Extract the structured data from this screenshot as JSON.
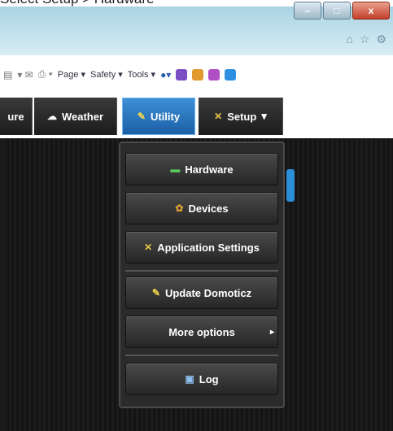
{
  "caption": "Select Setup > Hardware",
  "window": {
    "buttons": [
      "–",
      "□",
      "x"
    ],
    "toolbar_icons": [
      "home-icon",
      "star-icon",
      "gear-icon"
    ]
  },
  "command_bar": {
    "items": [
      {
        "label": "Page ▾",
        "icon": "page-icon"
      },
      {
        "label": "Safety ▾",
        "icon": "safety-icon"
      },
      {
        "label": "Tools ▾",
        "icon": "tools-icon"
      }
    ]
  },
  "nav": {
    "tabs": [
      {
        "label": "ure",
        "icon": ""
      },
      {
        "label": "Weather",
        "icon": "cloud-icon"
      },
      {
        "label": "Utility",
        "icon": "wrench-icon",
        "active": true
      },
      {
        "label": "Setup",
        "icon": "tools-icon",
        "dropdown": "▾"
      }
    ]
  },
  "menu": {
    "items": [
      {
        "label": "Hardware",
        "icon": "hardware-icon"
      },
      {
        "label": "Devices",
        "icon": "devices-icon"
      },
      {
        "label": "Application Settings",
        "icon": "settings-icon"
      },
      {
        "label": "Update Domoticz",
        "icon": "update-icon"
      },
      {
        "label": "More options",
        "icon": "",
        "submenu": "▸"
      },
      {
        "label": "Log",
        "icon": "log-icon"
      }
    ]
  },
  "colors": {
    "accent": "#1b5fa6",
    "menu_bg": "#2b2b2b"
  }
}
